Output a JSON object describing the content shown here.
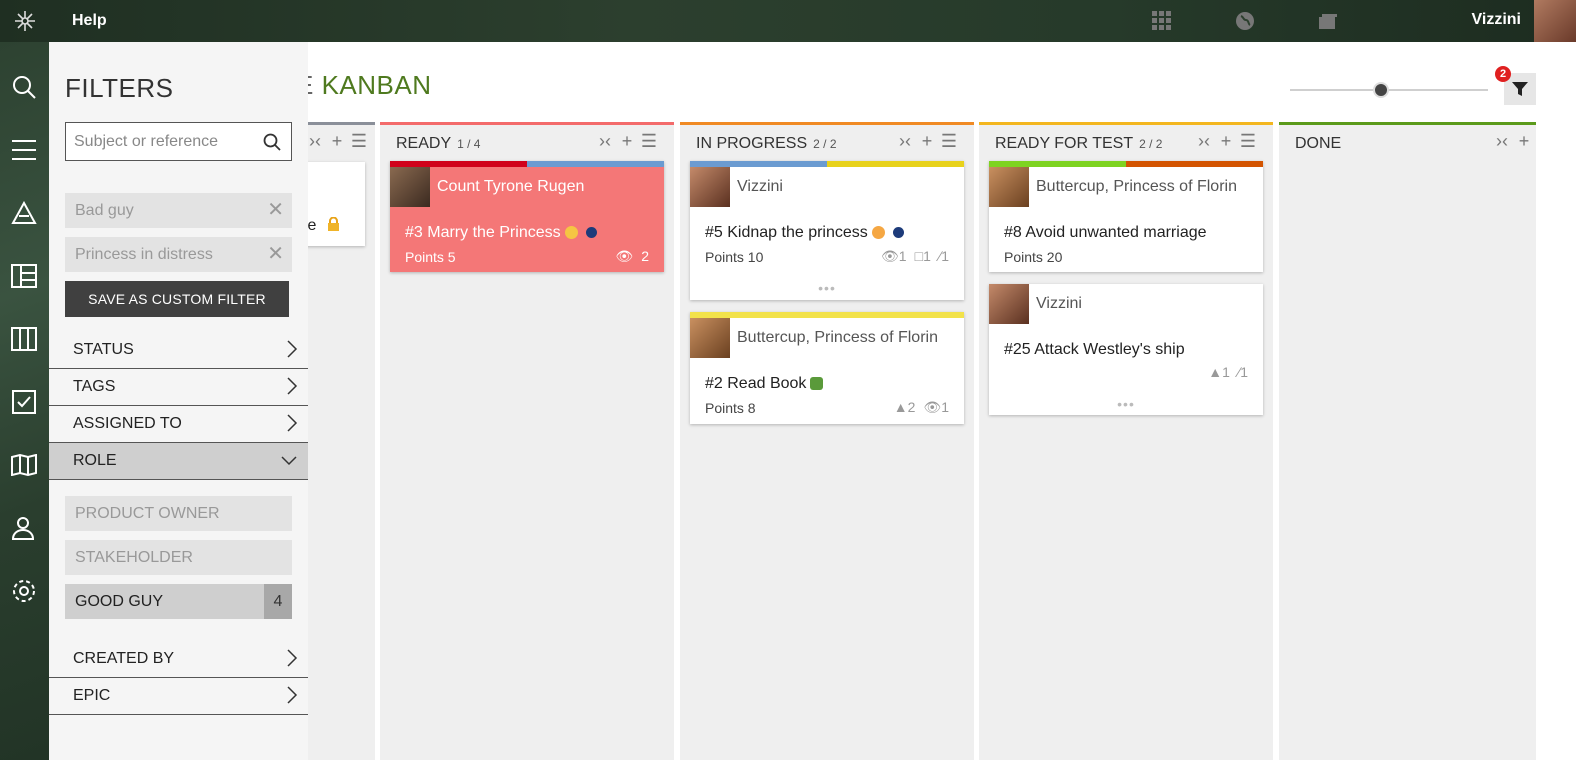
{
  "topbar": {
    "help_label": "Help",
    "user_name": "Vizzini"
  },
  "board": {
    "title_prefix": "E",
    "title": "KANBAN",
    "filter_count": "2",
    "zoom_level": 0.46
  },
  "filters": {
    "title": "FILTERS",
    "search_placeholder": "Subject or reference",
    "applied": [
      {
        "label": "Bad guy"
      },
      {
        "label": "Princess in distress"
      }
    ],
    "save_label": "SAVE AS CUSTOM FILTER",
    "categories": {
      "status": "STATUS",
      "tags": "TAGS",
      "assigned_to": "ASSIGNED TO",
      "role": "ROLE",
      "created_by": "CREATED BY",
      "epic": "EPIC"
    },
    "role_options": [
      {
        "label": "PRODUCT OWNER"
      },
      {
        "label": "STAKEHOLDER"
      },
      {
        "label": "GOOD GUY",
        "count": "4"
      }
    ]
  },
  "columns": {
    "partial": {
      "card_text": "te",
      "color": "#8a8f99"
    },
    "ready": {
      "title": "READY",
      "count": "1 / 4",
      "color": "#f36b6b",
      "card": {
        "owner": "Count Tyrone Rugen",
        "subject": "#3 Marry the Princess",
        "points": "Points 5",
        "watchers": "2"
      }
    },
    "in_progress": {
      "title": "IN PROGRESS",
      "count": "2 / 2",
      "color": "#f08a24",
      "cards": [
        {
          "owner": "Vizzini",
          "subject": "#5 Kidnap the princess",
          "points": "Points 10",
          "watchers": "1",
          "comments": "1",
          "attachments": "1"
        },
        {
          "owner": "Buttercup, Princess of Florin",
          "subject": "#2 Read Book",
          "points": "Points 8",
          "votes": "2",
          "watchers": "1"
        }
      ]
    },
    "ready_for_test": {
      "title": "READY FOR TEST",
      "count": "2 / 2",
      "color": "#f3b61f",
      "cards": [
        {
          "owner": "Buttercup, Princess of Florin",
          "subject": "#8 Avoid unwanted marriage",
          "points": "Points 20"
        },
        {
          "owner": "Vizzini",
          "subject": "#25 Attack Westley's ship",
          "votes": "1",
          "attachments": "1"
        }
      ]
    },
    "done": {
      "title": "DONE",
      "color": "#5b9a1b"
    }
  },
  "colors": {
    "accent_green": "#4f7a1f",
    "card_red": "#f47777",
    "tag_red": "#d0021b",
    "tag_blue": "#6b9bd1",
    "tag_yellow": "#e8d21b",
    "tag_green": "#7ed321",
    "tag_orange": "#d35400",
    "priority_blue": "#1d3b7a"
  }
}
